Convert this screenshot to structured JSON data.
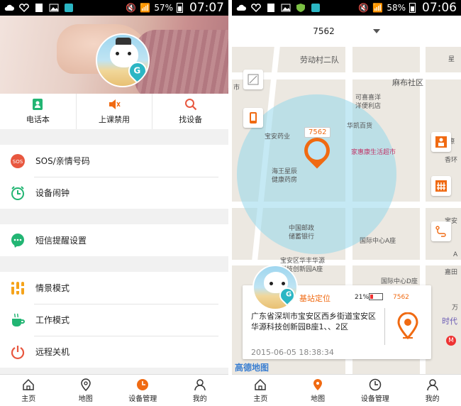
{
  "left": {
    "status": {
      "battery": "57%",
      "time": "07:07"
    },
    "quick": [
      {
        "label": "电话本",
        "icon": "phonebook-icon"
      },
      {
        "label": "上课禁用",
        "icon": "mute-icon"
      },
      {
        "label": "找设备",
        "icon": "search-icon"
      }
    ],
    "groups": [
      [
        {
          "label": "SOS/亲情号码",
          "icon": "sos-icon"
        },
        {
          "label": "设备闹钟",
          "icon": "alarm-icon"
        }
      ],
      [
        {
          "label": "短信提醒设置",
          "icon": "sms-icon"
        }
      ],
      [
        {
          "label": "情景模式",
          "icon": "scene-icon"
        },
        {
          "label": "工作模式",
          "icon": "work-mode-icon"
        },
        {
          "label": "远程关机",
          "icon": "power-icon"
        }
      ]
    ],
    "nav": [
      {
        "label": "主页",
        "icon": "home-icon"
      },
      {
        "label": "地图",
        "icon": "map-pin-icon"
      },
      {
        "label": "设备管理",
        "icon": "device-manage-icon",
        "active": true
      },
      {
        "label": "我的",
        "icon": "profile-icon"
      }
    ]
  },
  "right": {
    "status": {
      "battery": "58%",
      "time": "07:06"
    },
    "device": "7562",
    "map_labels": {
      "l1": "劳动村二队",
      "l2": "麻布社区",
      "l3": "可喜喜洋",
      "l4": "洋便利店",
      "l5": "华凯百货",
      "l6": "宝安药业",
      "l7": "家惠康生活超市",
      "l8": "海王星辰",
      "l9": "健康药房",
      "l10": "中国邮政",
      "l11": "储蓄银行",
      "l12": "国际中心A座",
      "l13": "宝安区华丰华源",
      "l14": "科技创新园A座",
      "l15": "国际中心D座",
      "l16": "嘉田",
      "l17": "时代",
      "l18": "星際",
      "l19": "香环",
      "l20": "宝安",
      "l21": "A",
      "l22": "万",
      "l23": "市",
      "l24": "星"
    },
    "marker_label": "7562",
    "info": {
      "tag": "基站定位",
      "battery": "21%",
      "device": "7562",
      "address": "广东省深圳市宝安区西乡街道宝安区华源科技创新园B座1、、2区",
      "time": "2015-06-05 18:38:34"
    },
    "watermark": "高德地图",
    "corner_badge": "M",
    "nav": [
      {
        "label": "主页",
        "icon": "home-icon"
      },
      {
        "label": "地图",
        "icon": "map-pin-icon",
        "active": true
      },
      {
        "label": "设备管理",
        "icon": "device-manage-icon"
      },
      {
        "label": "我的",
        "icon": "profile-icon"
      }
    ]
  },
  "colors": {
    "accent": "#f06a12",
    "teal": "#2bb6c4",
    "green": "#22b573",
    "red": "#e8573f"
  }
}
